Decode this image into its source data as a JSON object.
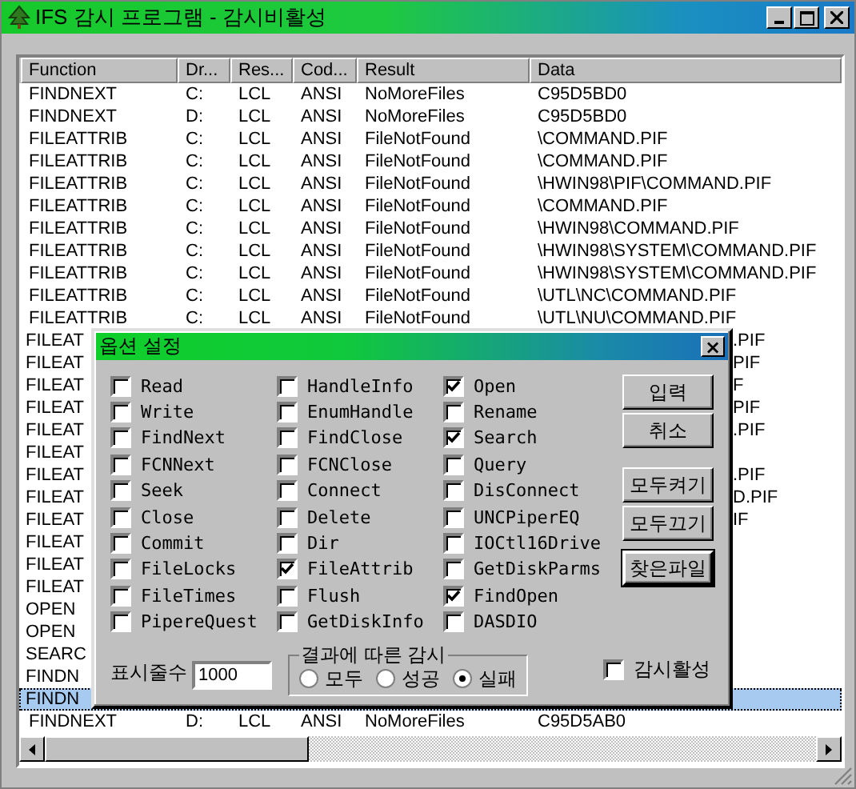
{
  "window": {
    "title": "IFS 감시 프로그램 - 감시비활성"
  },
  "table": {
    "columns": [
      "Function",
      "Dr...",
      "Res...",
      "Cod...",
      "Result",
      "Data"
    ],
    "rows": [
      {
        "kind": "full",
        "selected": false,
        "cells": [
          "FINDNEXT",
          "C:",
          "LCL",
          "ANSI",
          "NoMoreFiles",
          "C95D5BD0"
        ]
      },
      {
        "kind": "full",
        "selected": false,
        "cells": [
          "FINDNEXT",
          "D:",
          "LCL",
          "ANSI",
          "NoMoreFiles",
          "C95D5BD0"
        ]
      },
      {
        "kind": "full",
        "selected": false,
        "cells": [
          "FILEATTRIB",
          "C:",
          "LCL",
          "ANSI",
          "FileNotFound",
          "\\COMMAND.PIF"
        ]
      },
      {
        "kind": "full",
        "selected": false,
        "cells": [
          "FILEATTRIB",
          "C:",
          "LCL",
          "ANSI",
          "FileNotFound",
          "\\COMMAND.PIF"
        ]
      },
      {
        "kind": "full",
        "selected": false,
        "cells": [
          "FILEATTRIB",
          "C:",
          "LCL",
          "ANSI",
          "FileNotFound",
          "\\HWIN98\\PIF\\COMMAND.PIF"
        ]
      },
      {
        "kind": "full",
        "selected": false,
        "cells": [
          "FILEATTRIB",
          "C:",
          "LCL",
          "ANSI",
          "FileNotFound",
          "\\COMMAND.PIF"
        ]
      },
      {
        "kind": "full",
        "selected": false,
        "cells": [
          "FILEATTRIB",
          "C:",
          "LCL",
          "ANSI",
          "FileNotFound",
          "\\HWIN98\\COMMAND.PIF"
        ]
      },
      {
        "kind": "full",
        "selected": false,
        "cells": [
          "FILEATTRIB",
          "C:",
          "LCL",
          "ANSI",
          "FileNotFound",
          "\\HWIN98\\SYSTEM\\COMMAND.PIF"
        ]
      },
      {
        "kind": "full",
        "selected": false,
        "cells": [
          "FILEATTRIB",
          "C:",
          "LCL",
          "ANSI",
          "FileNotFound",
          "\\HWIN98\\SYSTEM\\COMMAND.PIF"
        ]
      },
      {
        "kind": "full",
        "selected": false,
        "cells": [
          "FILEATTRIB",
          "C:",
          "LCL",
          "ANSI",
          "FileNotFound",
          "\\UTL\\NC\\COMMAND.PIF"
        ]
      },
      {
        "kind": "full",
        "selected": false,
        "cells": [
          "FILEATTRIB",
          "C:",
          "LCL",
          "ANSI",
          "FileNotFound",
          "\\UTL\\NU\\COMMAND.PIF"
        ]
      },
      {
        "kind": "covered",
        "selected": false,
        "function": "FILEAT",
        "data": ".PIF"
      },
      {
        "kind": "covered",
        "selected": false,
        "function": "FILEAT",
        "data": "PIF"
      },
      {
        "kind": "covered",
        "selected": false,
        "function": "FILEAT",
        "data": "F"
      },
      {
        "kind": "covered",
        "selected": false,
        "function": "FILEAT",
        "data": "PIF"
      },
      {
        "kind": "covered",
        "selected": false,
        "function": "FILEAT",
        "data": ".PIF"
      },
      {
        "kind": "covered",
        "selected": false,
        "function": "FILEAT"
      },
      {
        "kind": "covered",
        "selected": false,
        "function": "FILEAT",
        "data": ".PIF"
      },
      {
        "kind": "covered",
        "selected": false,
        "function": "FILEAT",
        "data": "D.PIF"
      },
      {
        "kind": "covered",
        "selected": false,
        "function": "FILEAT",
        "data": "IF"
      },
      {
        "kind": "covered",
        "selected": false,
        "function": "FILEAT"
      },
      {
        "kind": "covered",
        "selected": false,
        "function": "FILEAT"
      },
      {
        "kind": "covered",
        "selected": false,
        "function": "FILEAT"
      },
      {
        "kind": "covered",
        "selected": false,
        "function": "OPEN"
      },
      {
        "kind": "covered",
        "selected": false,
        "function": "OPEN"
      },
      {
        "kind": "covered",
        "selected": false,
        "function": "SEARC"
      },
      {
        "kind": "covered",
        "selected": false,
        "function": "FINDN"
      },
      {
        "kind": "covered",
        "selected": true,
        "function": "FINDN"
      },
      {
        "kind": "full",
        "selected": false,
        "cells": [
          "FINDNEXT",
          "D:",
          "LCL",
          "ANSI",
          "NoMoreFiles",
          "C95D5AB0"
        ]
      }
    ]
  },
  "dialog": {
    "title": "옵션 설정",
    "close": "×",
    "option_columns": [
      [
        {
          "label": "Read",
          "checked": false
        },
        {
          "label": "Write",
          "checked": false
        },
        {
          "label": "FindNext",
          "checked": false
        },
        {
          "label": "FCNNext",
          "checked": false
        },
        {
          "label": "Seek",
          "checked": false
        },
        {
          "label": "Close",
          "checked": false
        },
        {
          "label": "Commit",
          "checked": false
        },
        {
          "label": "FileLocks",
          "checked": false
        },
        {
          "label": "FileTimes",
          "checked": false
        },
        {
          "label": "PipereQuest",
          "checked": false
        }
      ],
      [
        {
          "label": "HandleInfo",
          "checked": false
        },
        {
          "label": "EnumHandle",
          "checked": false
        },
        {
          "label": "FindClose",
          "checked": false
        },
        {
          "label": "FCNClose",
          "checked": false
        },
        {
          "label": "Connect",
          "checked": false
        },
        {
          "label": "Delete",
          "checked": false
        },
        {
          "label": "Dir",
          "checked": false
        },
        {
          "label": "FileAttrib",
          "checked": true
        },
        {
          "label": "Flush",
          "checked": false
        },
        {
          "label": "GetDiskInfo",
          "checked": false
        }
      ],
      [
        {
          "label": "Open",
          "checked": true
        },
        {
          "label": "Rename",
          "checked": false
        },
        {
          "label": "Search",
          "checked": true
        },
        {
          "label": "Query",
          "checked": false
        },
        {
          "label": "DisConnect",
          "checked": false
        },
        {
          "label": "UNCPiperEQ",
          "checked": false
        },
        {
          "label": "IOCtl16Drive",
          "checked": false
        },
        {
          "label": "GetDiskParms",
          "checked": false
        },
        {
          "label": "FindOpen",
          "checked": true
        },
        {
          "label": "DASDIO",
          "checked": false
        }
      ]
    ],
    "buttons": [
      {
        "label": "입력",
        "kind": "normal"
      },
      {
        "label": "취소",
        "kind": "normal"
      },
      {
        "label": "모두켜기",
        "kind": "normal"
      },
      {
        "label": "모두끄기",
        "kind": "normal"
      },
      {
        "label": "찾은파일",
        "kind": "default"
      }
    ],
    "line_count": {
      "label": "표시줄수",
      "value": "1000"
    },
    "result_filter": {
      "title": "결과에 따른 감시",
      "options": [
        {
          "label": "모두",
          "selected": false
        },
        {
          "label": "성공",
          "selected": false
        },
        {
          "label": "실패",
          "selected": true
        }
      ]
    },
    "monitor_active": {
      "label": "감시활성",
      "checked": false
    }
  }
}
